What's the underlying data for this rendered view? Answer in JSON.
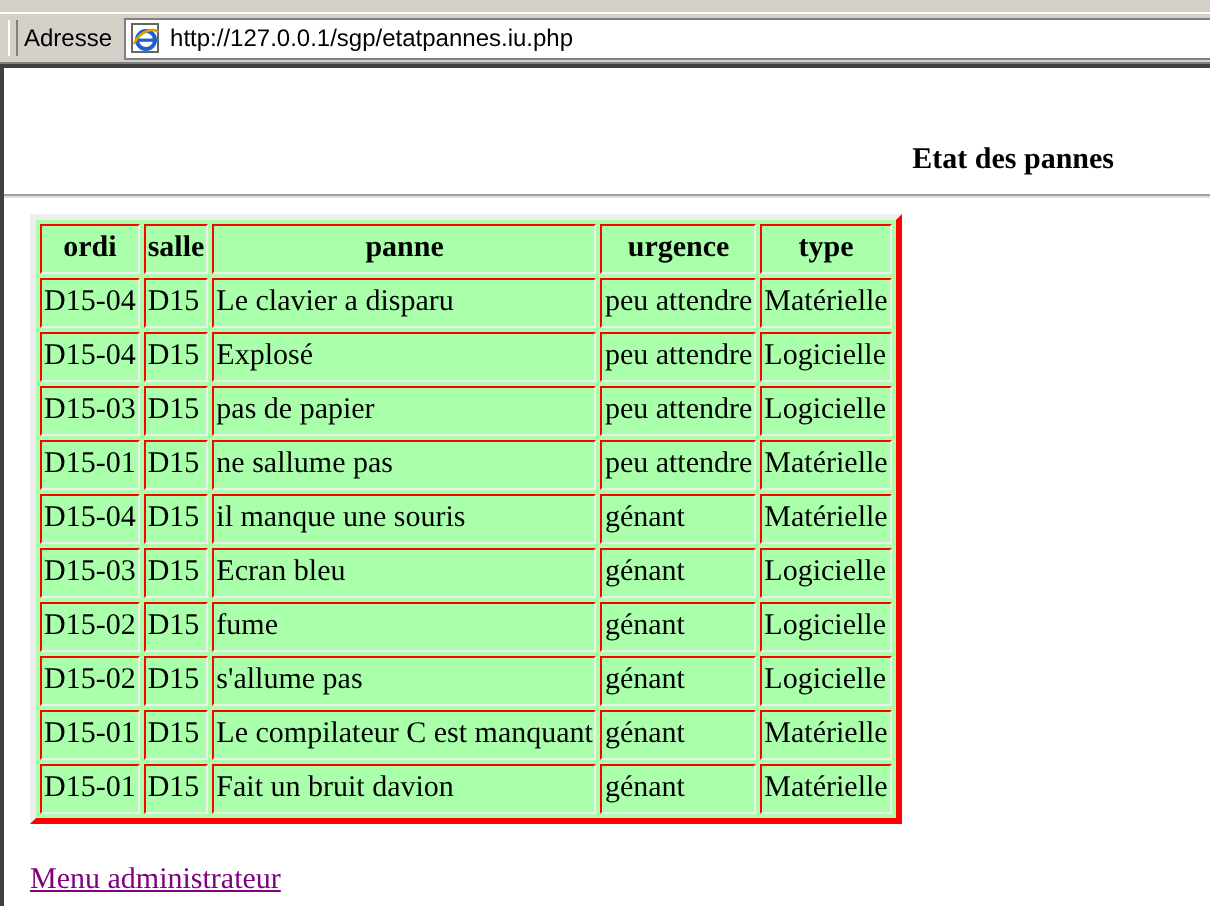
{
  "address_bar": {
    "label": "Adresse",
    "url": "http://127.0.0.1/sgp/etatpannes.iu.php"
  },
  "page": {
    "title": "Etat des pannes",
    "table": {
      "columns": [
        "ordi",
        "salle",
        "panne",
        "urgence",
        "type"
      ],
      "rows": [
        [
          "D15-04",
          "D15",
          "Le clavier a disparu",
          "peu attendre",
          "Matérielle"
        ],
        [
          "D15-04",
          "D15",
          "Explosé",
          "peu attendre",
          "Logicielle"
        ],
        [
          "D15-03",
          "D15",
          "pas de papier",
          "peu attendre",
          "Logicielle"
        ],
        [
          "D15-01",
          "D15",
          "ne sallume pas",
          "peu attendre",
          "Matérielle"
        ],
        [
          "D15-04",
          "D15",
          "il manque une souris",
          "génant",
          "Matérielle"
        ],
        [
          "D15-03",
          "D15",
          "Ecran bleu",
          "génant",
          "Logicielle"
        ],
        [
          "D15-02",
          "D15",
          "fume",
          "génant",
          "Logicielle"
        ],
        [
          "D15-02",
          "D15",
          "s'allume pas",
          "génant",
          "Logicielle"
        ],
        [
          "D15-01",
          "D15",
          "Le compilateur C est manquant",
          "génant",
          "Matérielle"
        ],
        [
          "D15-01",
          "D15",
          "Fait un bruit davion",
          "génant",
          "Matérielle"
        ]
      ]
    },
    "link": "Menu administrateur"
  }
}
